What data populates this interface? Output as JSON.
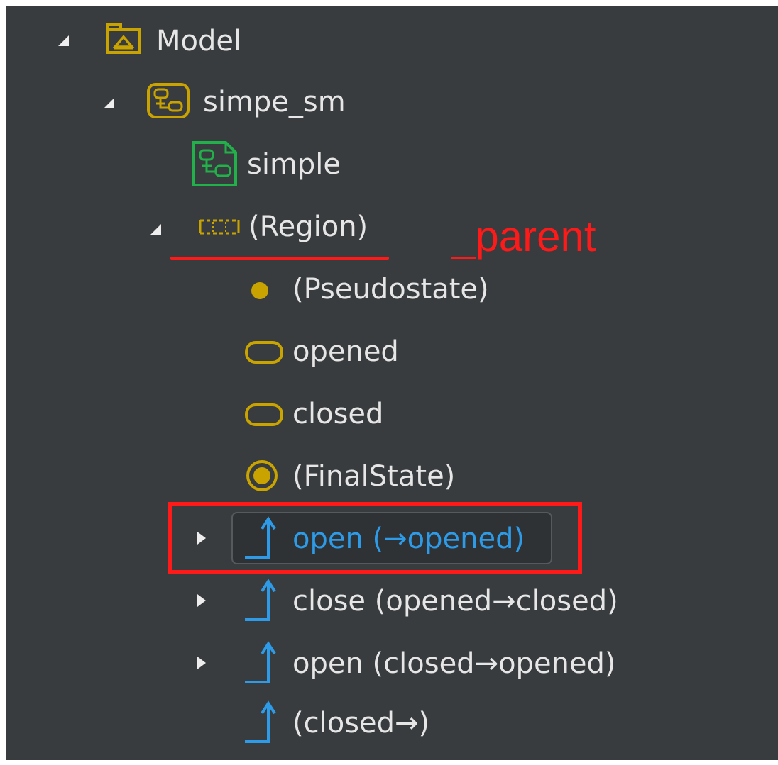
{
  "tree": {
    "model": {
      "label": "Model",
      "icon": "package-icon"
    },
    "state_machine": {
      "label": "simpe_sm",
      "icon": "state-machine-icon"
    },
    "diagram": {
      "label": "simple",
      "icon": "state-machine-diagram-icon"
    },
    "region": {
      "label": "(Region)",
      "icon": "region-icon"
    },
    "pseudostate": {
      "label": "(Pseudostate)",
      "icon": "initial-pseudostate-icon"
    },
    "state_opened": {
      "label": "opened",
      "icon": "state-icon"
    },
    "state_closed": {
      "label": "closed",
      "icon": "state-icon"
    },
    "final_state": {
      "label": "(FinalState)",
      "icon": "final-state-icon"
    },
    "transitions": [
      {
        "label": "open (→opened)",
        "icon": "transition-icon",
        "selected": true
      },
      {
        "label": "close (opened→closed)",
        "icon": "transition-icon"
      },
      {
        "label": "open (closed→opened)",
        "icon": "transition-icon"
      },
      {
        "label": "(closed→)",
        "icon": "transition-icon"
      }
    ]
  },
  "annotation": {
    "text": "_parent"
  },
  "colors": {
    "panel_bg": "#383c3f",
    "text": "#e6e6e6",
    "selected_text": "#2e9be8",
    "uml_gold": "#c9a300",
    "diagram_green": "#22b04a",
    "transition_blue": "#2e9be8",
    "annotation_red": "#ff1a1a"
  }
}
